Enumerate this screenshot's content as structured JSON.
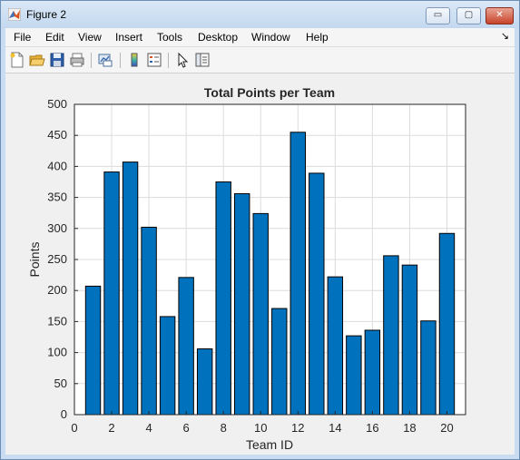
{
  "window": {
    "title": "Figure 2",
    "controls": {
      "minimize": "▭",
      "maximize": "▢",
      "close": "✕"
    }
  },
  "menu": {
    "items": [
      "File",
      "Edit",
      "View",
      "Insert",
      "Tools",
      "Desktop",
      "Window",
      "Help"
    ],
    "overflow_arrow": "↘"
  },
  "toolbar": {
    "icons": [
      "new-figure-icon",
      "open-file-icon",
      "save-icon",
      "print-icon",
      "link-plot-icon",
      "colorbar-icon",
      "legend-icon",
      "pointer-icon",
      "property-editor-icon"
    ]
  },
  "colors": {
    "bar_fill": "#0072bd",
    "bar_edge": "#000000",
    "figure_bg": "#f0f0f0",
    "axes_bg": "#ffffff",
    "grid": "#dcdcdc"
  },
  "chart_data": {
    "type": "bar",
    "title": "Total Points per Team",
    "xlabel": "Team ID",
    "ylabel": "Points",
    "x": [
      1,
      2,
      3,
      4,
      5,
      6,
      7,
      8,
      9,
      10,
      11,
      12,
      13,
      14,
      15,
      16,
      17,
      18,
      19,
      20
    ],
    "values": [
      207,
      391,
      407,
      302,
      158,
      221,
      106,
      375,
      356,
      324,
      171,
      455,
      389,
      222,
      127,
      136,
      256,
      241,
      151,
      292
    ],
    "xlim": [
      0,
      21
    ],
    "ylim": [
      0,
      500
    ],
    "xticks": [
      "0",
      "2",
      "4",
      "6",
      "8",
      "10",
      "12",
      "14",
      "16",
      "18",
      "20"
    ],
    "yticks": [
      "0",
      "50",
      "100",
      "150",
      "200",
      "250",
      "300",
      "350",
      "400",
      "450",
      "500"
    ],
    "grid": true
  }
}
